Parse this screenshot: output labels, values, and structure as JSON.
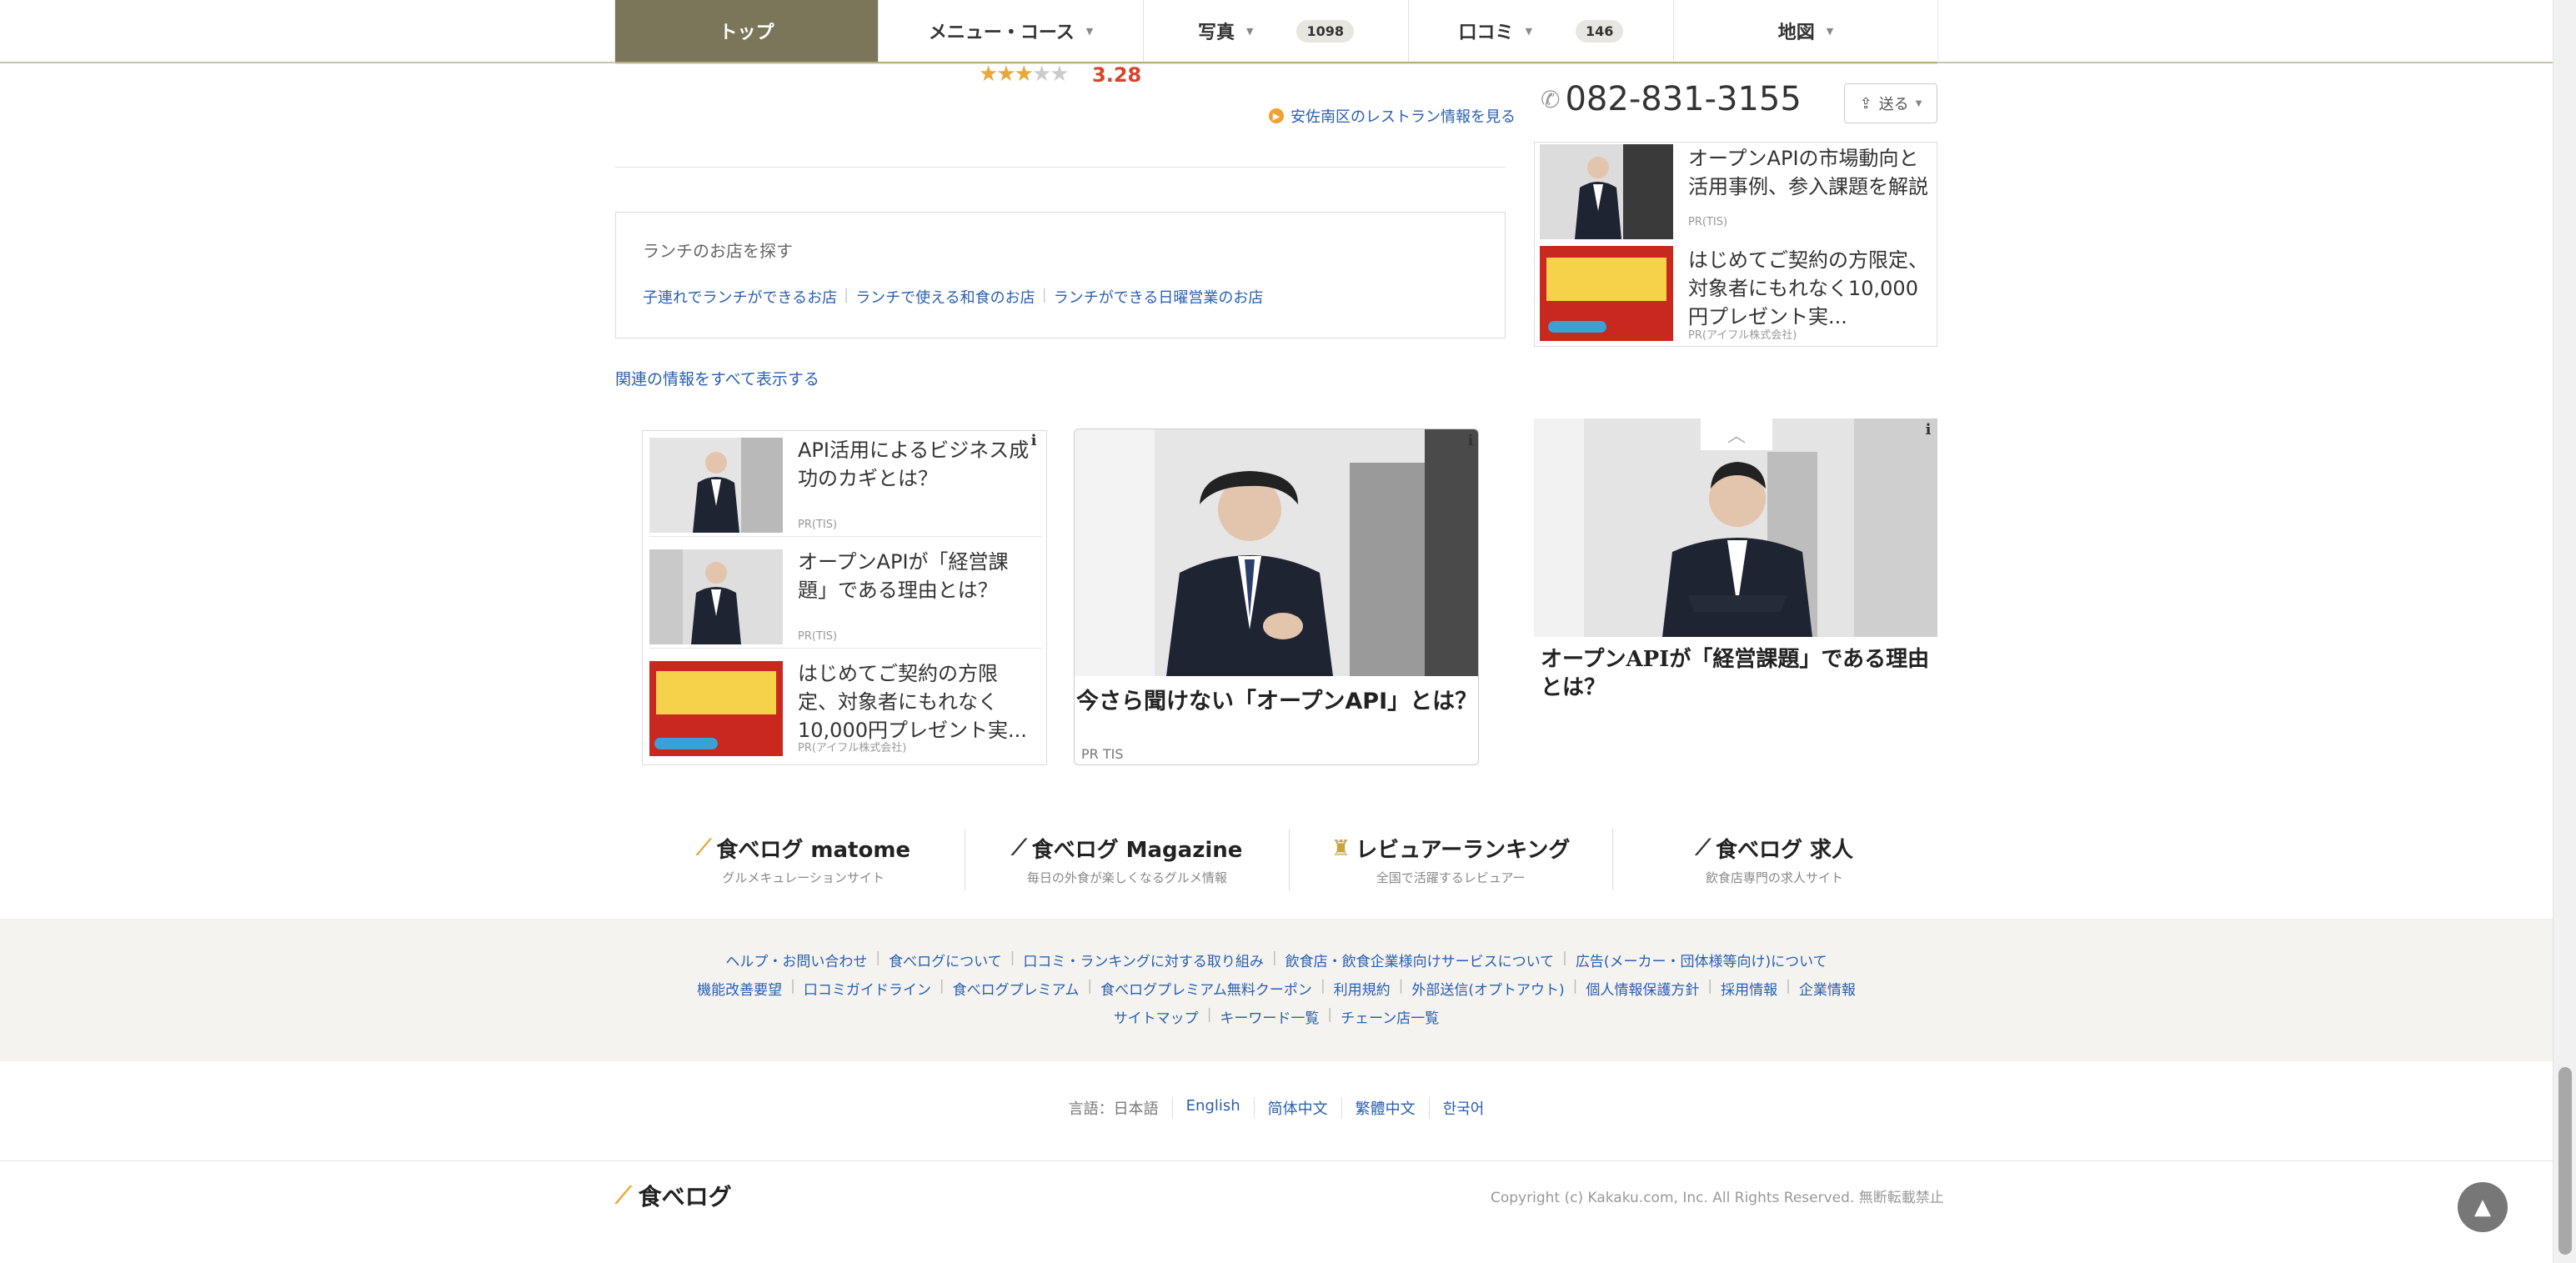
{
  "nav": {
    "tabs": [
      {
        "label": "トップ"
      },
      {
        "label": "メニュー・コース"
      },
      {
        "label": "写真",
        "count": "1098"
      },
      {
        "label": "口コミ",
        "count": "146"
      },
      {
        "label": "地図"
      }
    ]
  },
  "rating": {
    "value": "3.28",
    "stars_filled": 3,
    "stars_total": 5
  },
  "area_link": "安佐南区のレストラン情報を見る",
  "lunch": {
    "title": "ランチのお店を探す",
    "links": [
      "子連れでランチができるお店",
      "ランチで使える和食のお店",
      "ランチができる日曜営業のお店"
    ]
  },
  "related_all": "関連の情報をすべて表示する",
  "phone": "082-831-3155",
  "send_label": "送る",
  "right_ads": [
    {
      "text": "オープンAPIの市場動向と活用事例、参入課題を解説",
      "pr": "PR(TIS)"
    },
    {
      "text": "はじめてご契約の方限定、対象者にもれなく10,000円プレゼント実...",
      "pr": "PR(アイフル株式会社)"
    }
  ],
  "ad_list": [
    {
      "text": "API活用によるビジネス成功のカギとは？",
      "pr": "PR(TIS)"
    },
    {
      "text": "オープンAPIが「経営課題」である理由とは？",
      "pr": "PR(TIS)"
    },
    {
      "text": "はじめてご契約の方限定、対象者にもれなく10,000円プレゼント実...",
      "pr": "PR(アイフル株式会社)"
    }
  ],
  "ad_card": {
    "title": "今さら聞けない「オープンAPI」とは？",
    "pr": "PR TIS"
  },
  "ad_big": {
    "title": "オープンAPIが「経営課題」である理由とは？"
  },
  "services": [
    {
      "logo": "食べログ matome",
      "sub": "グルメキュレーションサイト"
    },
    {
      "logo": "食べログ Magazine",
      "sub": "毎日の外食が楽しくなるグルメ情報"
    },
    {
      "logo": "レビュアーランキング",
      "sub": "全国で活躍するレビュアー"
    },
    {
      "logo": "食べログ 求人",
      "sub": "飲食店専門の求人サイト"
    }
  ],
  "footer": {
    "row1": [
      "ヘルプ・お問い合わせ",
      "食べログについて",
      "口コミ・ランキングに対する取り組み",
      "飲食店・飲食企業様向けサービスについて",
      "広告(メーカー・団体様等向け)について"
    ],
    "row2": [
      "機能改善要望",
      "口コミガイドライン",
      "食べログプレミアム",
      "食べログプレミアム無料クーポン",
      "利用規約",
      "外部送信(オプトアウト)",
      "個人情報保護方針",
      "採用情報",
      "企業情報"
    ],
    "row3": [
      "サイトマップ",
      "キーワード一覧",
      "チェーン店一覧"
    ]
  },
  "languages": {
    "label": "言語：日本語",
    "items": [
      "English",
      "简体中文",
      "繁體中文",
      "한국어"
    ]
  },
  "bottom_logo": "食べログ",
  "copyright": "Copyright (c) Kakaku.com, Inc. All Rights Reserved. 無断転載禁止",
  "colors": {
    "nav_active": "#7b7559",
    "link": "#2a5fb0",
    "rating": "#d3452c",
    "star": "#e8a93a"
  }
}
